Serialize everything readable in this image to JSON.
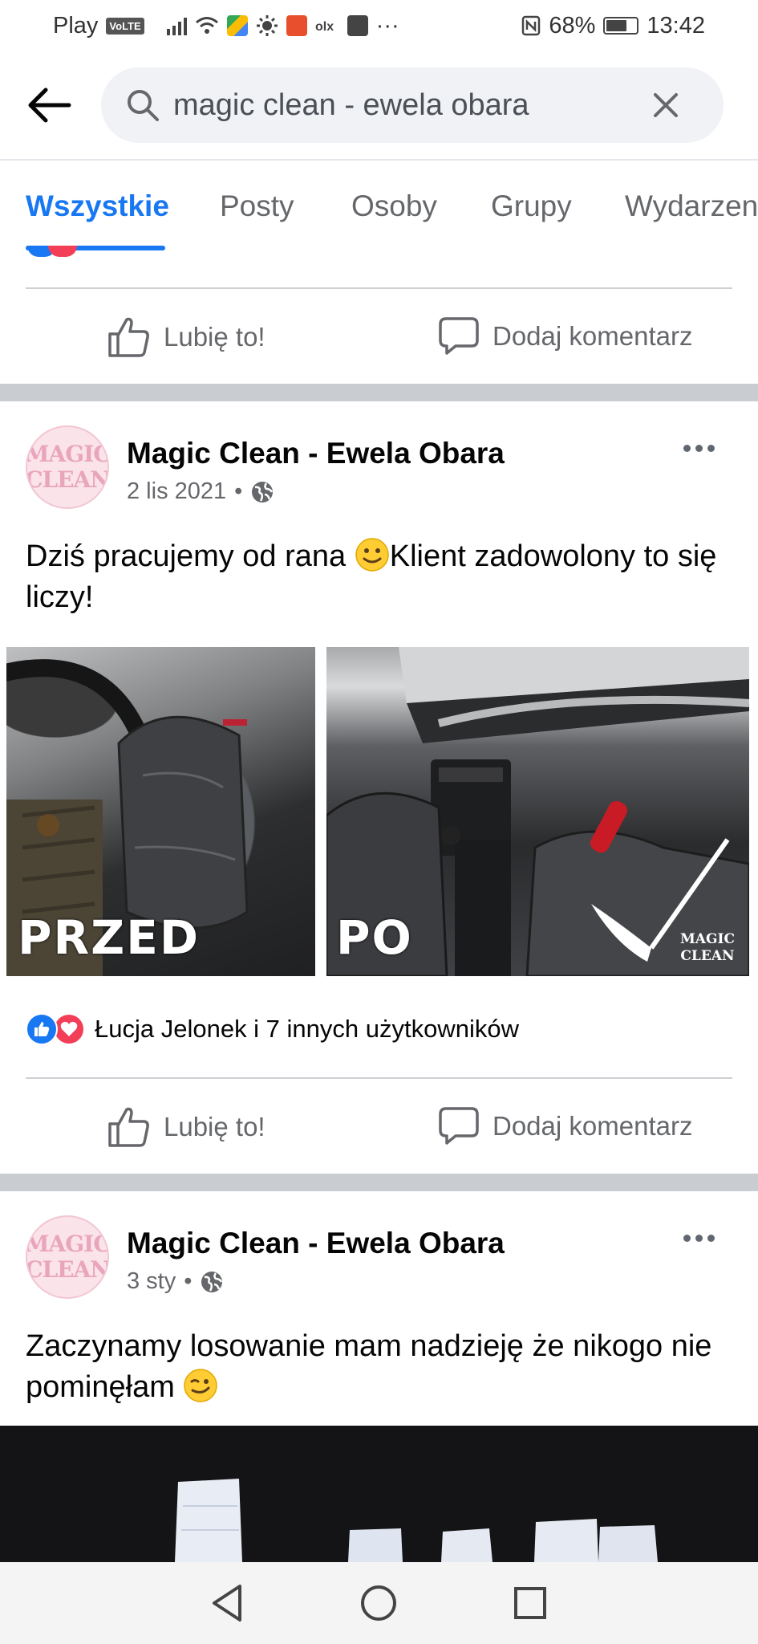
{
  "status_bar": {
    "carrier": "Play",
    "volte": "VoLTE",
    "battery": "68%",
    "time": "13:42"
  },
  "search": {
    "query": "magic clean - ewela obara"
  },
  "tabs": [
    "Wszystkie",
    "Posty",
    "Osoby",
    "Grupy",
    "Wydarzen"
  ],
  "actions": {
    "like": "Lubię to!",
    "comment": "Dodaj komentarz"
  },
  "posts": [
    {
      "author": "Magic Clean - Ewela Obara",
      "avatar_line1": "MAGIC",
      "avatar_line2": "CLEAN",
      "date": "2 lis 2021",
      "text": "Dziś pracujemy od rana ",
      "text_after_emoji": "Klient zadowolony to się liczy!",
      "emoji": "slightly-smiling-face",
      "photo_left_label": "PRZED",
      "photo_right_label": "PO",
      "watermark_line1": "MAGIC",
      "watermark_line2": "CLEAN",
      "reactions": "Łucja Jelonek i 7 innych użytkowników"
    },
    {
      "author": "Magic Clean - Ewela Obara",
      "avatar_line1": "MAGIC",
      "avatar_line2": "CLEAN",
      "date": "3 sty",
      "text": "Zaczynamy losowanie mam nadzieję że nikogo nie pominęłam ",
      "emoji": "winking-face"
    }
  ],
  "colors": {
    "accent": "#1877f2",
    "secondary_text": "#65676b",
    "separator": "#c9ccd1",
    "love": "#f33e58"
  }
}
